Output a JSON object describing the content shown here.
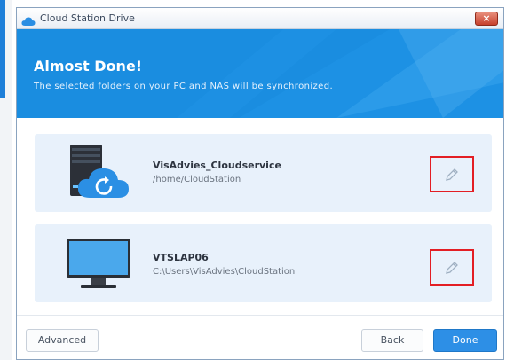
{
  "window": {
    "title": "Cloud Station Drive",
    "close_glyph": "×"
  },
  "header": {
    "title": "Almost Done!",
    "subtitle": "The selected folders on your PC and NAS will be synchronized."
  },
  "nas": {
    "name": "VisAdvies_Cloudservice",
    "path": "/home/CloudStation"
  },
  "pc": {
    "name": "VTSLAP06",
    "path": "C:\\Users\\VisAdvies\\CloudStation"
  },
  "buttons": {
    "advanced": "Advanced",
    "back": "Back",
    "done": "Done"
  },
  "colors": {
    "accent": "#1a8de0",
    "highlight": "#e31e24"
  },
  "icons": {
    "app": "cloud-icon",
    "nas": "nas-server-sync-icon",
    "pc": "monitor-icon",
    "edit": "pencil-icon"
  }
}
